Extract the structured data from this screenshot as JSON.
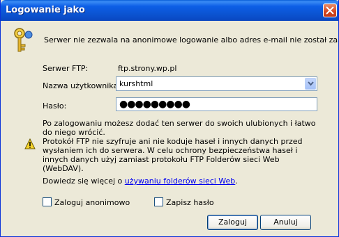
{
  "window": {
    "title": "Logowanie jako"
  },
  "message": "Serwer nie zezwala na anonimowe logowanie albo adres e-mail nie został zaakceptowany.",
  "form": {
    "ftp_server_label": "Serwer FTP:",
    "ftp_server_value": "ftp.strony.wp.pl",
    "username_label": "Nazwa użytkownika:",
    "username_value": "kurshtml",
    "password_label": "Hasło:",
    "password_mask": "●●●●●●●●●"
  },
  "notice": {
    "line1": "Po zalogowaniu możesz dodać ten serwer do swoich ulubionych i łatwo do niego wrócić.",
    "line2": "Protokół FTP nie szyfruje ani nie koduje haseł i innych danych przed wysłaniem ich do serwera. W celu ochrony bezpieczeństwa haseł i innych danych użyj zamiast protokołu FTP Folderów sieci Web (WebDAV)."
  },
  "learn_more": {
    "prefix": "Dowiedz się więcej o ",
    "link": "używaniu folderów sieci Web",
    "suffix": "."
  },
  "checkboxes": {
    "anonymous": "Zaloguj anonimowo",
    "save_password": "Zapisz hasło"
  },
  "buttons": {
    "ok": "Zaloguj",
    "cancel": "Anuluj"
  },
  "icons": {
    "close": "close-icon",
    "key": "key-icon",
    "warning": "warning-icon",
    "dropdown": "chevron-down-icon"
  }
}
